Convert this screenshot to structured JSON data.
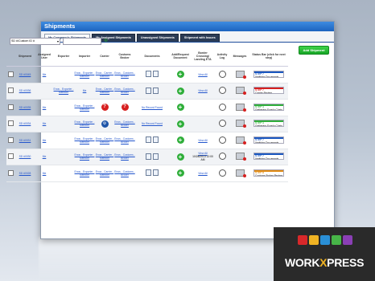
{
  "window": {
    "title": "Shipments"
  },
  "tabs": [
    {
      "label": "My Company's Shipments",
      "active": true
    },
    {
      "label": "My Assigned Shipments",
      "active": false
    },
    {
      "label": "Unassigned Shipments",
      "active": false
    },
    {
      "label": "Shipment with Issues",
      "active": false
    }
  ],
  "toolbar": {
    "add_label": "Add Shipment"
  },
  "search": {
    "field_label": "SD #/Custom ID #"
  },
  "columns": [
    "",
    "Shipment",
    "Assigned User",
    "Exporter",
    "Importer",
    "Carrier",
    "Customs Broker",
    "Documents",
    "Add/Request Document",
    "Border Crossing/ Landing ETA",
    "Activity Log",
    "Messages",
    "Status Bar (click for next step)"
  ],
  "rows": [
    {
      "shipment": "SD #0045",
      "user": "Me",
      "exporter": "",
      "importer": "Enos - Exporter - Member",
      "carrier": "Enos - Carrier - Member",
      "broker": "Enos - Customs - Broker",
      "docs": "icons",
      "view": "View All",
      "eta": "",
      "step": "STEP 7",
      "step_sub": "Verifying Documents",
      "bar_color": "#1a57c0"
    },
    {
      "shipment": "SD #0036",
      "user": "",
      "exporter": "Enos - Exporter - Member",
      "importer": "Me",
      "carrier": "Enos - Carrier - Member",
      "broker": "Enos - Customs - Broker",
      "docs": "icons",
      "view": "View All",
      "eta": "",
      "step": "STEP 7",
      "step_sub": "Carrier Review",
      "bar_color": "#d61f1f"
    },
    {
      "shipment": "SD #0035",
      "user": "Me",
      "exporter": "",
      "importer": "Enos - Exporter - Member",
      "carrier": "carrier-missing",
      "broker": "broker-missing",
      "docs": "No Record Found",
      "view": "",
      "eta": "",
      "step": "STEP 1",
      "step_sub": "Gathering Supply Chain",
      "bar_color": "#2fae3a"
    },
    {
      "shipment": "SD #0034",
      "user": "Me",
      "exporter": "",
      "importer": "Enos - Exporter - Member",
      "carrier": "carrier-blue",
      "broker": "Enos - Customs - Broker",
      "docs": "No Record Found",
      "view": "",
      "eta": "",
      "step": "STEP 1",
      "step_sub": "Gathering Supply Chain",
      "bar_color": "#2fae3a"
    },
    {
      "shipment": "SD #0031",
      "user": "Me",
      "exporter": "",
      "importer": "Enos - Exporter - Member",
      "carrier": "Enos - Carrier - Member",
      "broker": "Enos - Customs - Broker",
      "docs": "icons",
      "view": "View All",
      "eta": "",
      "step": "STEP 7",
      "step_sub": "Verifying Documents",
      "bar_color": "#1a57c0"
    },
    {
      "shipment": "SD #0030",
      "user": "Me",
      "exporter": "",
      "importer": "Enos - Exporter - Member",
      "carrier": "Enos - Carrier - Member",
      "broker": "Enos - Customs - Broker",
      "docs": "icons",
      "view": "View All",
      "eta": "10/28/2013 12:00 AM",
      "step": "STEP 7",
      "step_sub": "Verifying Documents",
      "bar_color": "#1a57c0"
    },
    {
      "shipment": "SD #0028",
      "user": "Me",
      "exporter": "",
      "importer": "Enos - Exporter - Member",
      "carrier": "Enos - Carrier - Member",
      "broker": "Enos - Customs - Broker",
      "docs": "icons",
      "view": "View All",
      "eta": "",
      "step": "STEP 8",
      "step_sub": "Customs Broker Review",
      "bar_color": "#e08a12"
    }
  ],
  "logo": {
    "text_a": "WORK",
    "text_b": "X",
    "text_c": "PRESS",
    "cube_colors": [
      "#d8282a",
      "#f0b323",
      "#2a8fd6",
      "#47b548",
      "#8a3fb5"
    ]
  }
}
